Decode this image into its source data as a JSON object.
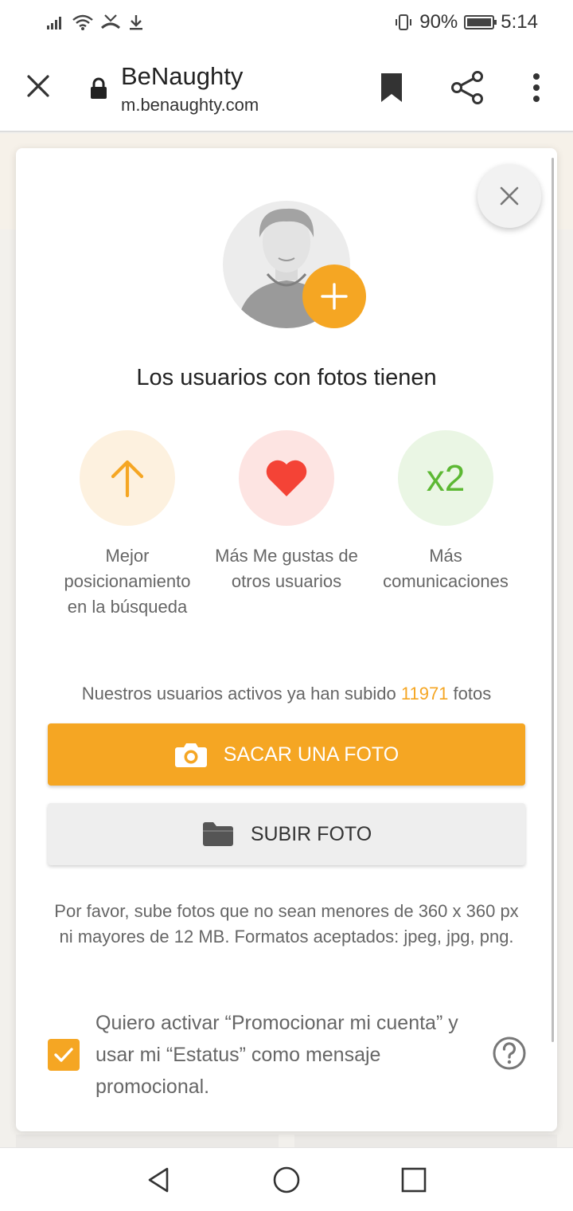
{
  "status_bar": {
    "battery": "90%",
    "time": "5:14",
    "battery_level": 0.9
  },
  "browser": {
    "title": "BeNaughty",
    "url": "m.benaughty.com"
  },
  "modal": {
    "headline": "Los usuarios con fotos tienen",
    "benefits": [
      {
        "icon": "arrow-up-icon",
        "label": "Mejor posicionamiento en la búsqueda"
      },
      {
        "icon": "heart-icon",
        "label": "Más Me gustas de otros usuarios"
      },
      {
        "icon": "x2",
        "badge": "x2",
        "label": "Más comunicaciones"
      }
    ],
    "stats": {
      "prefix": "Nuestros usuarios activos ya han subido",
      "count": "11971",
      "suffix": "fotos"
    },
    "take_photo_label": "SACAR UNA FOTO",
    "upload_photo_label": "SUBIR FOTO",
    "note": "Por favor, sube fotos que no sean menores de 360 x 360 px ni mayores de 12 MB. Formatos aceptados: jpeg, jpg, png.",
    "promo_checkbox": {
      "checked": true,
      "label": "Quiero activar “Promocionar mi cuenta” y usar mi “Estatus” como mensaje promocional."
    }
  },
  "colors": {
    "accent": "#f5a623",
    "heart": "#f44336",
    "green": "#5cb833"
  }
}
